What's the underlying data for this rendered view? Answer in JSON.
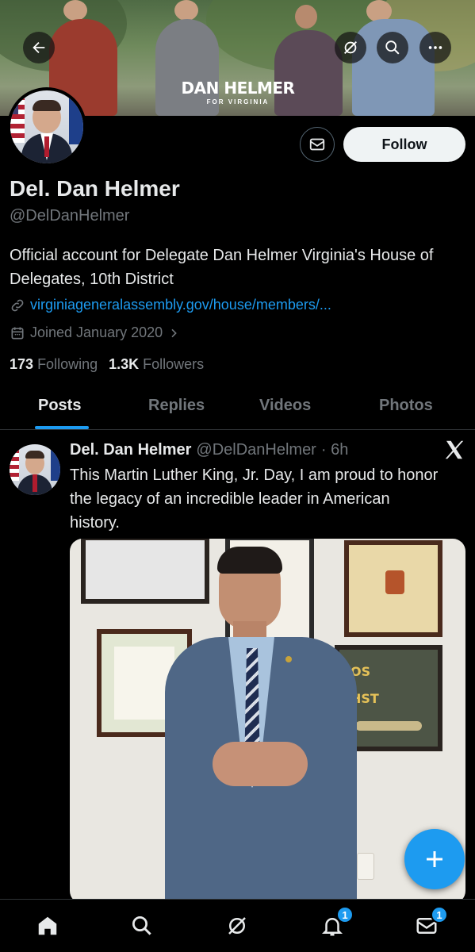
{
  "banner": {
    "logo_main": "DAN HELMER",
    "logo_sub": "FOR VIRGINIA"
  },
  "header_icons": [
    "back-arrow-icon",
    "grok-icon",
    "search-icon",
    "more-icon"
  ],
  "profile": {
    "name": "Del. Dan Helmer",
    "handle": "@DelDanHelmer",
    "bio": "Official account for Delegate Dan Helmer Virginia's House of Delegates, 10th District",
    "link": "virginiageneralassembly.gov/house/members/...",
    "joined": "Joined January 2020",
    "following_count": "173",
    "following_label": "Following",
    "followers_count": "1.3K",
    "followers_label": "Followers",
    "follow_button": "Follow"
  },
  "tabs": [
    {
      "label": "Posts",
      "active": true
    },
    {
      "label": "Replies",
      "active": false
    },
    {
      "label": "Videos",
      "active": false
    },
    {
      "label": "Photos",
      "active": false
    }
  ],
  "post": {
    "author": "Del. Dan Helmer",
    "handle": "@DelDanHelmer",
    "time": "· 6h",
    "text": "This Martin Luther King, Jr. Day, I am proud to honor the legacy of an incredible leader in American history.",
    "media_sign_1": "OS",
    "media_sign_2": "HST"
  },
  "bottom_nav": [
    {
      "icon": "home-icon",
      "badge": null
    },
    {
      "icon": "search-icon",
      "badge": null
    },
    {
      "icon": "grok-icon",
      "badge": null
    },
    {
      "icon": "bell-icon",
      "badge": "1"
    },
    {
      "icon": "mail-icon",
      "badge": "1"
    }
  ],
  "colors": {
    "accent": "#1d9bf0",
    "background": "#000000",
    "muted": "#71767b"
  }
}
